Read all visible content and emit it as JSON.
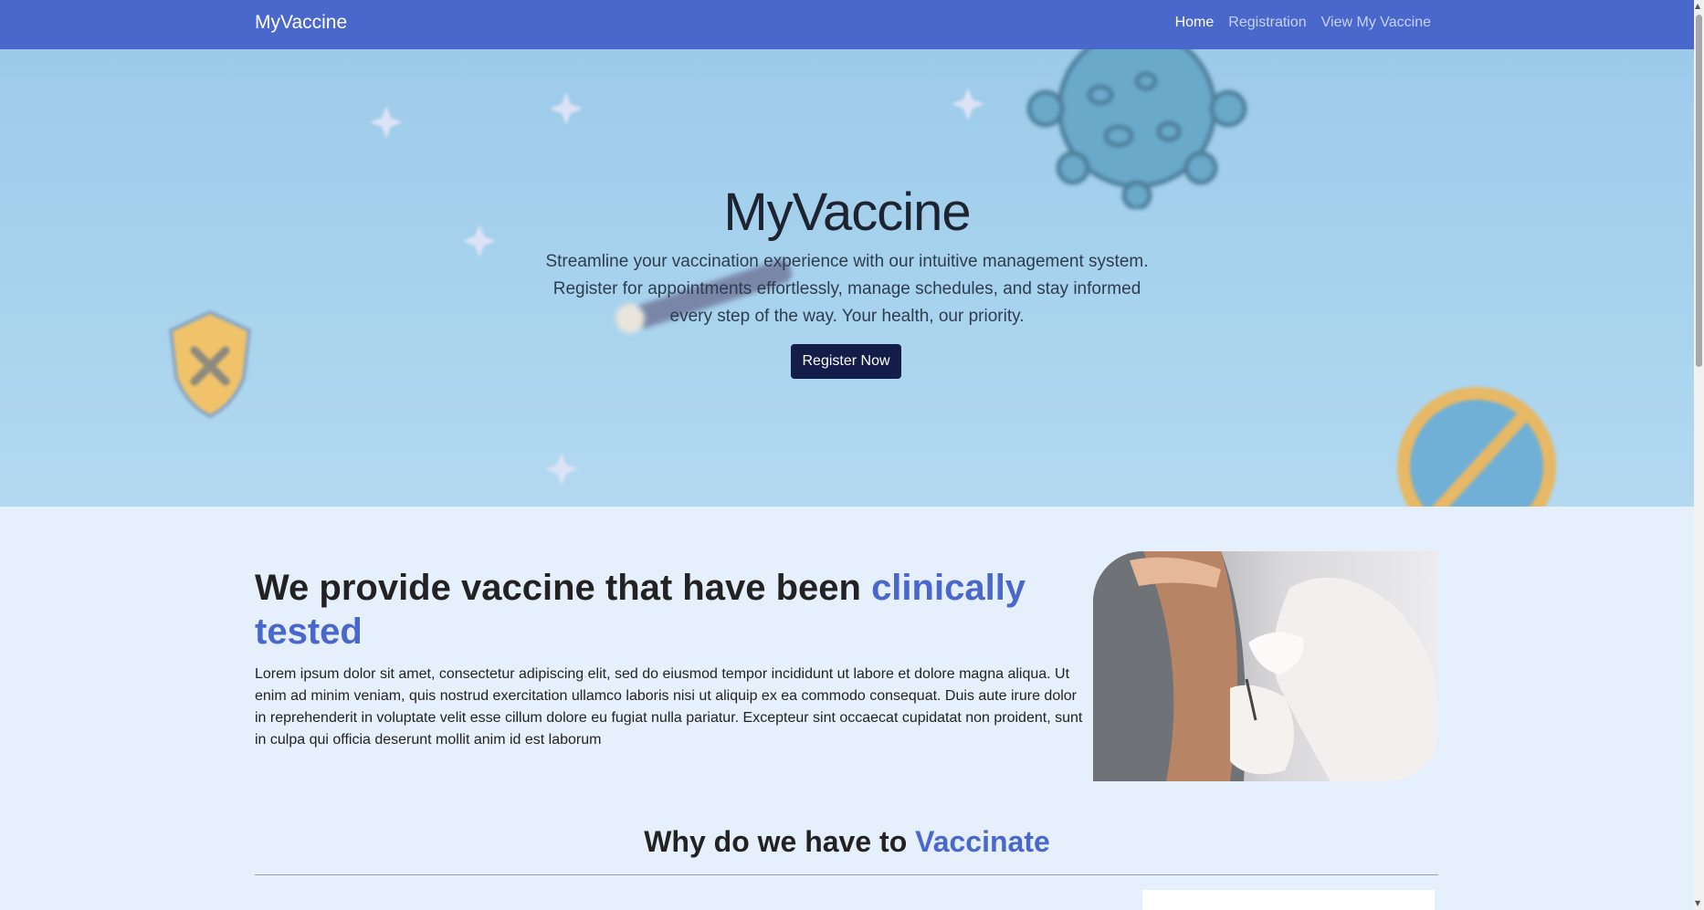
{
  "navbar": {
    "brand": "MyVaccine",
    "links": [
      {
        "label": "Home",
        "active": true
      },
      {
        "label": "Registration",
        "active": false
      },
      {
        "label": "View My Vaccine",
        "active": false
      }
    ]
  },
  "hero": {
    "title": "MyVaccine",
    "text": "Streamline your vaccination experience with our intuitive management system. Register for appointments effortlessly, manage schedules, and stay informed every step of the way. Your health, our priority.",
    "button_label": "Register Now"
  },
  "about": {
    "title_part1": "We provide vaccine that have been ",
    "title_accent": "clinically tested",
    "body": "Lorem ipsum dolor sit amet, consectetur adipiscing elit, sed do eiusmod tempor incididunt ut labore et dolore magna aliqua. Ut enim ad minim veniam, quis nostrud exercitation ullamco laboris nisi ut aliquip ex ea commodo consequat. Duis aute irure dolor in reprehenderit in voluptate velit esse cillum dolore eu fugiat nulla pariatur. Excepteur sint occaecat cupidatat non proident, sunt in culpa qui officia deserunt mollit anim id est laborum"
  },
  "why": {
    "title_part1": "Why do we have to ",
    "title_accent": "Vaccinate"
  },
  "colors": {
    "navbar": "#4a67cc",
    "accent": "#4a67cc",
    "button": "#141c4a",
    "page_background": "#e6f0fd"
  },
  "icons": [
    "virus-icon",
    "shield-icon",
    "syringe-icon",
    "no-virus-icon",
    "sparkle-icon"
  ]
}
